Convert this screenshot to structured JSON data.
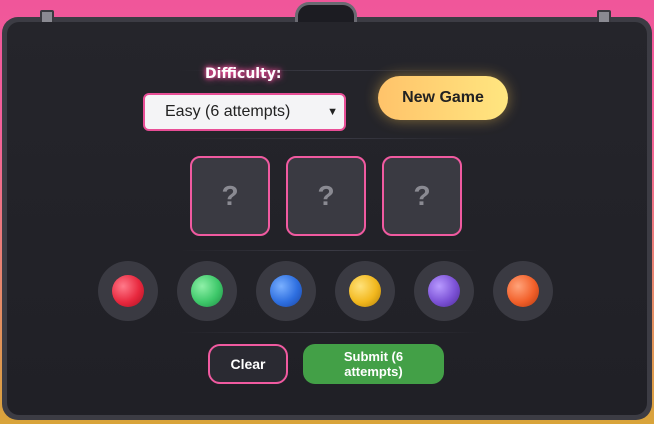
{
  "difficulty": {
    "label": "Difficulty:",
    "selected": "Easy (6 attempts)"
  },
  "buttons": {
    "new_game": "New Game",
    "clear": "Clear",
    "submit": "Submit (6 attempts)"
  },
  "slots": [
    "?",
    "?",
    "?"
  ],
  "palette": [
    {
      "name": "red",
      "color": "#e8283e"
    },
    {
      "name": "green",
      "color": "#3ec86a"
    },
    {
      "name": "blue",
      "color": "#2e6fe0"
    },
    {
      "name": "yellow",
      "color": "#f2b81e"
    },
    {
      "name": "purple",
      "color": "#7c52d6"
    },
    {
      "name": "orange",
      "color": "#f2602a"
    }
  ],
  "colors": {
    "accent_pink": "#f05aa0",
    "submit_green": "#43a047",
    "new_game_gradient_start": "#ffc36a",
    "new_game_gradient_end": "#ffe680"
  }
}
